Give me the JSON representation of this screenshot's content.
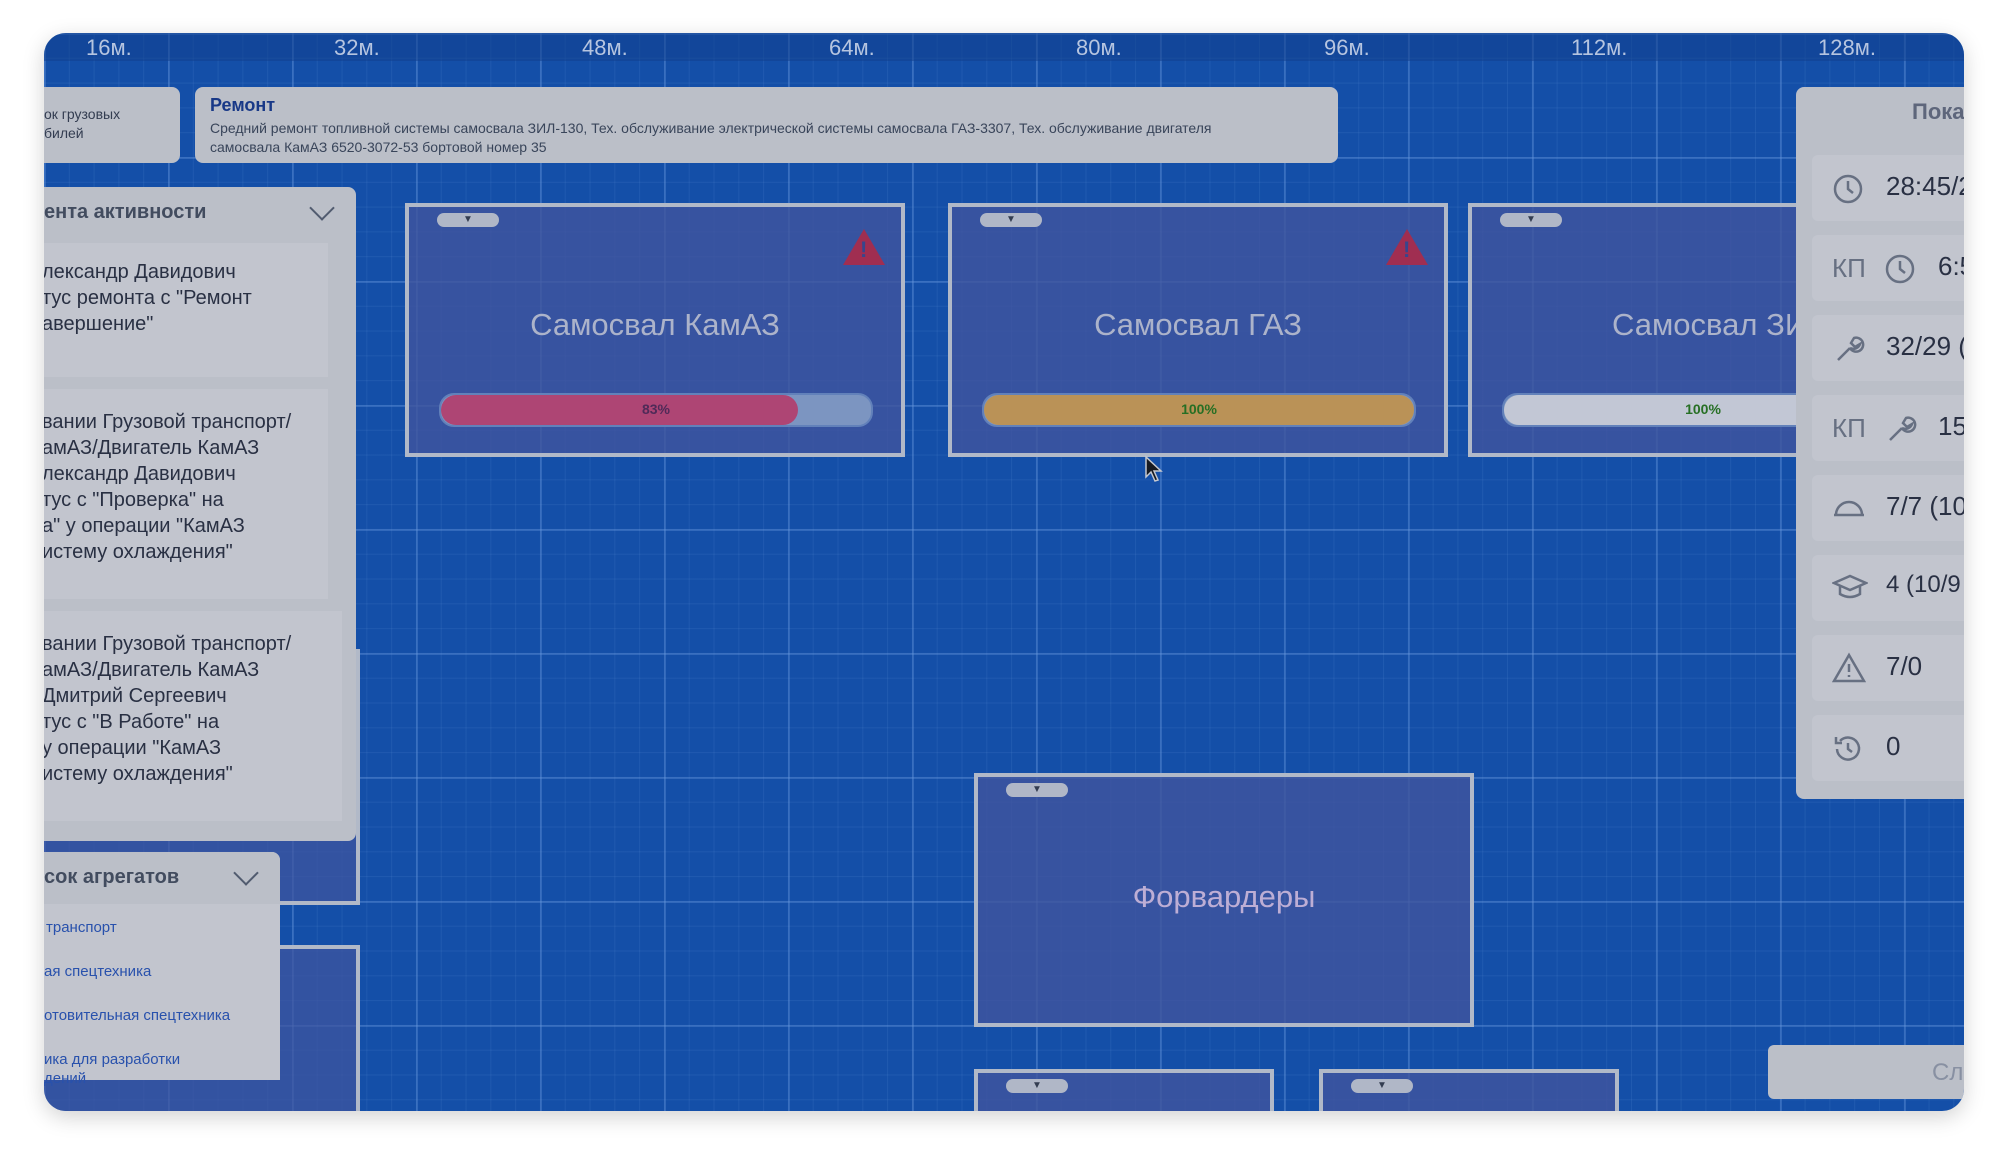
{
  "ruler": [
    "16м.",
    "32м.",
    "48м.",
    "64м.",
    "80м.",
    "96м.",
    "112м.",
    "128м."
  ],
  "left_card": {
    "line1": "ок грузовых",
    "line2": "билей"
  },
  "notice": {
    "title": "Ремонт",
    "text": "Средний ремонт топливной системы самосвала ЗИЛ-130, Тех. обслуживание электрической системы самосвала ГАЗ-3307, Тех. обслуживание двигателя самосвала КамАЗ 6520-3072-53 бортовой номер 35"
  },
  "activity_feed": {
    "title": "ента активности",
    "items": [
      "лександр Давидович\nтус ремонта с \"Ремонт\nавершение\"",
      "вании Грузовой транспорт/\nамАЗ/Двигатель КамАЗ\nлександр Давидович\nтус с \"Проверка\" на\nа\" у операции \"КамАЗ\nистему охлаждения\"",
      "вании Грузовой транспорт/\nамАЗ/Двигатель КамАЗ\nДмитрий Сергеевич\nтус с \"В Работе\" на\nу операции \"КамАЗ\nистему охлаждения\""
    ]
  },
  "aggregates": {
    "title": "сок агрегатов",
    "items": [
      "транспорт",
      "ая спецтехника",
      "отовительная спецтехника",
      "ика для разработки\nдений"
    ]
  },
  "machines": [
    {
      "name": "Самосвал КамАЗ",
      "progress": "83%",
      "fill": 0.83,
      "color": "#c54a78",
      "warning": true
    },
    {
      "name": "Самосвал ГАЗ",
      "progress": "100%",
      "fill": 1.0,
      "color": "#d3a257",
      "warning": true
    },
    {
      "name": "Самосвал ЗИ",
      "progress": "100%",
      "fill": 1.0,
      "color": "#dcdfe6",
      "warning": false
    },
    {
      "name": "Форвардеры"
    }
  ],
  "stats": {
    "header": "Пока",
    "rows": [
      {
        "icon": "clock-icon",
        "value": "28:45/2"
      },
      {
        "icon": "clock-icon",
        "kp": "КП",
        "value": "6:5"
      },
      {
        "icon": "wrench-icon",
        "value": "32/29 ("
      },
      {
        "icon": "wrench-icon",
        "kp": "КП",
        "value": "15,"
      },
      {
        "icon": "helmet-icon",
        "value": "7/7 (10"
      },
      {
        "icon": "graduation-cap-icon",
        "value": "4  (10/9"
      },
      {
        "icon": "warning-icon",
        "value": "7/0"
      },
      {
        "icon": "history-icon",
        "value": "0"
      }
    ]
  },
  "next_button": "Сл"
}
